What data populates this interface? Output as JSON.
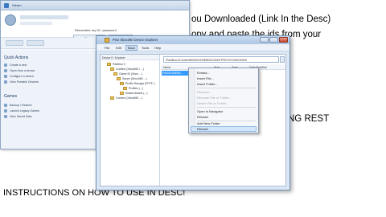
{
  "background_text": {
    "line1": "ou Downloaded (Link In the Desc)",
    "line2": "opy and paste the ids from your",
    "line3": "NG REST",
    "line4": "INSTRUCTIONS ON HOW TO USE IN DESC!"
  },
  "left_window": {
    "title": "Steam",
    "checkbox_label": "Remember my ID / password",
    "button_label": "Sign in",
    "sections": {
      "quick_actions": "Quick Actions",
      "items_a": [
        "Create a new",
        "Open from a device",
        "Configure a device",
        "View Portable Devices"
      ],
      "games": "Games",
      "items_b": [
        "Backup / Restore",
        "Launch Legacy Games",
        "View Saved Data"
      ]
    }
  },
  "explorer": {
    "title": "PS3 Xbox360 Device Explorer",
    "menu": [
      "File",
      "Edit",
      "Back",
      "Tools",
      "Help"
    ],
    "tree_header": "Device 0 / Explorer",
    "tree_items": [
      "Partition 0",
      "Content (Xbox360 / ...)",
      "Game ID (Xbox ...)",
      "Saves (Xbox360 ...)",
      "Profile Storage (FFFF..)",
      "Profiles (...)",
      "Avatar Assets (...)",
      "Content (Xbox360 ...)"
    ],
    "address": "\\Partition1\\Content\\E00001D5EB00C20A\\FFFE07D1\\00010000",
    "columns": [
      "Name",
      "Size",
      "Type",
      "Date Modified"
    ],
    "selected_item": "E00001D5EB0..."
  },
  "context_menu": {
    "items": [
      {
        "label": "Extract...",
        "enabled": true
      },
      {
        "label": "Insert File...",
        "enabled": true
      },
      {
        "label": "Insert Folder...",
        "enabled": true
      },
      {
        "label": "Rename...",
        "enabled": false
      },
      {
        "label": "Rename File or Folder...",
        "enabled": false
      },
      {
        "label": "Delete File or Folder...",
        "enabled": false
      },
      {
        "label": "Open in Navigator",
        "enabled": true
      },
      {
        "label": "Rehash",
        "enabled": true
      },
      {
        "label": "Add New Folder",
        "enabled": true
      },
      {
        "label": "Rehash",
        "enabled": true
      }
    ]
  }
}
